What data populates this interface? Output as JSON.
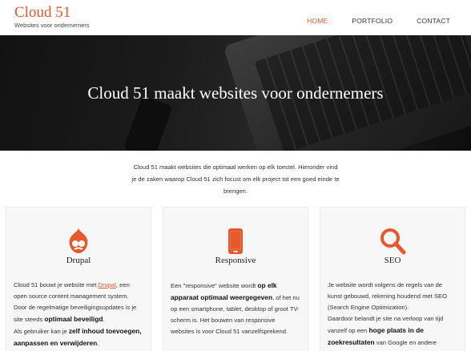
{
  "header": {
    "logo_title": "Cloud 51",
    "logo_tagline": "Websites voor ondernemers",
    "nav": [
      {
        "label": "HOME",
        "active": true
      },
      {
        "label": "PORTFOLIO",
        "active": false
      },
      {
        "label": "CONTACT",
        "active": false
      }
    ]
  },
  "hero": {
    "title": "Cloud 51 maakt websites voor ondernemers"
  },
  "intro": {
    "text": "Cloud 51 maakt websites die optimaal werken op elk toestel. Hieronder vind je de zaken waarop Cloud 51 zich focust om elk project tot een goed einde te brengen."
  },
  "colors": {
    "accent": "#e8582d",
    "hero_bg": "#2a2a2a",
    "card_bg": "#f7f7f7"
  },
  "cards": [
    {
      "icon": "drupal-icon",
      "title": "Drupal",
      "p1_a": "Cloud 51 bouwt je website met ",
      "p1_link": "Drupal",
      "p1_b": ", een open source content management system. Door de regelmatige beveiligingsupdates is je site steeds ",
      "p1_bold": "optimaal beveiligd",
      "p1_c": ".",
      "p2_a": "Als gebruiker kan je ",
      "p2_bold": "zelf inhoud toevoegen, aanpassen en verwijderen",
      "p2_c": "."
    },
    {
      "icon": "smartphone-icon",
      "title": "Responsive",
      "p1_a": "Een \"responsive\" website wordt ",
      "p1_bold": "op elk apparaat optimaal weergegeven",
      "p1_b": ", of het nu op een smartphone, tablet, desktop of groot TV-scherm is. Het bouwen van responsive websites is voor Cloud 51 vanzelfsprekend."
    },
    {
      "icon": "magnifier-icon",
      "title": "SEO",
      "p1_a": "Je website wordt volgens de regels van de kunst gebouwd, rekening houdend met SEO (Search Engine Optimization).",
      "p2_a": "Daardoor belandt je site na verloop van tijd vanzelf op een ",
      "p2_bold": "hoge plaats in de zoekresultaten",
      "p2_c": " van Google en andere"
    }
  ]
}
